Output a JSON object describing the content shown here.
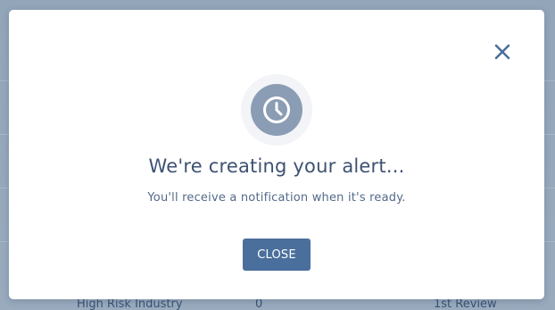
{
  "background": {
    "table_row": {
      "label": "High Risk Industry",
      "count": "0",
      "stage": "1st Review"
    }
  },
  "modal": {
    "title": "We're creating your alert...",
    "message": "You'll receive a notification when it's ready.",
    "close_button_label": "CLOSE",
    "icons": {
      "close": "close-icon",
      "status": "clock-icon"
    }
  },
  "colors": {
    "primary": "#4a6f9c",
    "icon_bg": "#8b9db5",
    "text": "#3d5273"
  }
}
